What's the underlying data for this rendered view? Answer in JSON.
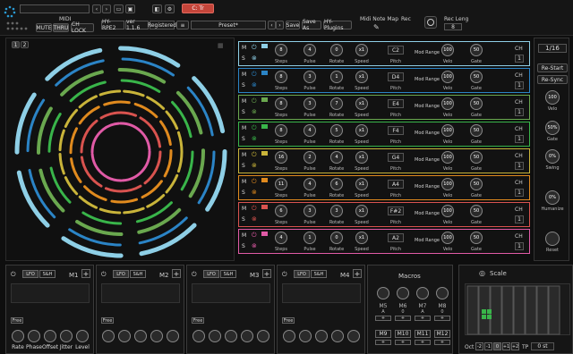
{
  "topbar": {
    "midi_label": "MIDI",
    "mute": "MUTE",
    "thru": "THRU",
    "ch_lock": "CH LOCK",
    "key_label": "C: Tr",
    "plugin_name": "HY-RPE2",
    "version": "ver 1.1.6",
    "registered": "Registered",
    "preset_name": "Preset*",
    "save": "Save",
    "save_as": "Save As",
    "brand": "HY-Plugins",
    "midi_note_map": "Midi Note Map",
    "rec_label": "Rec",
    "rec_leng_label": "Rec Leng",
    "rec_leng_value": "8"
  },
  "pages": [
    "1",
    "2"
  ],
  "tracks": [
    {
      "steps": "8",
      "pulse": "4",
      "rotate": "0",
      "speed": "x1",
      "pitch": "C2",
      "velo": "100",
      "gate": "50",
      "ch": "1",
      "color": "#8ecfe6"
    },
    {
      "steps": "8",
      "pulse": "3",
      "rotate": "1",
      "speed": "x1",
      "pitch": "D4",
      "velo": "100",
      "gate": "50",
      "ch": "1",
      "color": "#2b84c6"
    },
    {
      "steps": "8",
      "pulse": "3",
      "rotate": "7",
      "speed": "x1",
      "pitch": "E4",
      "velo": "100",
      "gate": "50",
      "ch": "1",
      "color": "#6aa84f"
    },
    {
      "steps": "8",
      "pulse": "4",
      "rotate": "5",
      "speed": "x1",
      "pitch": "F4",
      "velo": "100",
      "gate": "50",
      "ch": "1",
      "color": "#39b54a"
    },
    {
      "steps": "16",
      "pulse": "2",
      "rotate": "4",
      "speed": "x1",
      "pitch": "G4",
      "velo": "100",
      "gate": "50",
      "ch": "1",
      "color": "#c9b43a"
    },
    {
      "steps": "11",
      "pulse": "4",
      "rotate": "6",
      "speed": "x1",
      "pitch": "A4",
      "velo": "100",
      "gate": "50",
      "ch": "1",
      "color": "#e08a1e"
    },
    {
      "steps": "6",
      "pulse": "3",
      "rotate": "3",
      "speed": "x1",
      "pitch": "F#2",
      "velo": "100",
      "gate": "50",
      "ch": "1",
      "color": "#d9534f"
    },
    {
      "steps": "4",
      "pulse": "1",
      "rotate": "0",
      "speed": "x1",
      "pitch": "A2",
      "velo": "100",
      "gate": "50",
      "ch": "1",
      "color": "#e05aa6"
    }
  ],
  "track_labels": {
    "steps": "Steps",
    "pulse": "Pulse",
    "rotate": "Rotate",
    "speed": "Speed",
    "pitch": "Pitch",
    "velo": "Velo",
    "gate": "Gate",
    "ch": "CH",
    "mod_range": "Mod Range",
    "mute": "M",
    "solo": "S"
  },
  "side": {
    "division": "1/16",
    "restart": "Re-Start",
    "resync": "Re-Sync",
    "velo_value": "100",
    "velo_label": "Velo",
    "gate_value": "50%",
    "gate_label": "Gate",
    "swing_value": "0%",
    "swing_label": "Swing",
    "humanize_value": "0%",
    "humanize_label": "Humanize",
    "reset_label": "Reset"
  },
  "lfos": [
    {
      "name": "M1"
    },
    {
      "name": "M2"
    },
    {
      "name": "M3"
    },
    {
      "name": "M4"
    }
  ],
  "lfo_tabs": {
    "lfo": "LFO",
    "sh": "S&H",
    "free": "Free"
  },
  "lfo_knobs": [
    "Rate",
    "Phase",
    "Offset",
    "Jitter",
    "Level"
  ],
  "macros": {
    "title": "Macros",
    "row1": [
      "M5",
      "M6",
      "M7",
      "M8"
    ],
    "row1_values": [
      "A",
      "0",
      "A",
      "0"
    ],
    "row2": [
      "M9",
      "M10",
      "M11",
      "M12"
    ]
  },
  "scale": {
    "title": "Scale",
    "oct_label": "Oct",
    "oct_values": [
      "-2",
      "-1",
      "0",
      "+1",
      "+2"
    ],
    "tp_label": "TP",
    "tp_value": "0 st"
  }
}
